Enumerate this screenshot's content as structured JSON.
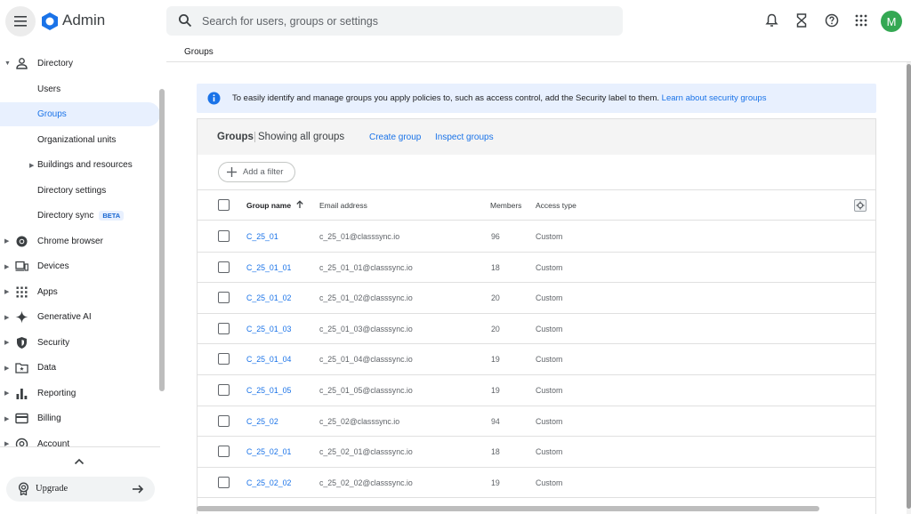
{
  "header": {
    "app_title": "Admin",
    "search_placeholder": "Search for users, groups or settings",
    "avatar_initial": "M"
  },
  "breadcrumb": "Groups",
  "sidebar": {
    "items": [
      {
        "label": "Directory",
        "icon": "person-icon",
        "expandable": true,
        "expanded": true
      },
      {
        "label": "Users",
        "level": 2
      },
      {
        "label": "Groups",
        "level": 2,
        "active": true
      },
      {
        "label": "Organizational units",
        "level": 2
      },
      {
        "label": "Buildings and resources",
        "level": 2,
        "expandable": true
      },
      {
        "label": "Directory settings",
        "level": 2
      },
      {
        "label": "Directory sync",
        "level": 2,
        "badge": "BETA"
      },
      {
        "label": "Chrome browser",
        "icon": "chrome-icon",
        "expandable": true
      },
      {
        "label": "Devices",
        "icon": "devices-icon",
        "expandable": true
      },
      {
        "label": "Apps",
        "icon": "apps-grid-icon",
        "expandable": true
      },
      {
        "label": "Generative AI",
        "icon": "sparkle-icon",
        "expandable": true
      },
      {
        "label": "Security",
        "icon": "shield-icon",
        "expandable": true
      },
      {
        "label": "Data",
        "icon": "folder-icon",
        "expandable": true
      },
      {
        "label": "Reporting",
        "icon": "bar-chart-icon",
        "expandable": true
      },
      {
        "label": "Billing",
        "icon": "credit-card-icon",
        "expandable": true
      },
      {
        "label": "Account",
        "icon": "account-icon",
        "expandable": true
      }
    ],
    "upgrade_label": "Upgrade"
  },
  "banner": {
    "text": "To easily identify and manage groups you apply policies to, such as access control, add the Security label to them.",
    "link": "Learn about security groups"
  },
  "card": {
    "title": "Groups",
    "subtitle": "Showing all groups",
    "create_link": "Create group",
    "inspect_link": "Inspect groups",
    "filter_label": "Add a filter"
  },
  "table": {
    "columns": {
      "name": "Group name",
      "email": "Email address",
      "members": "Members",
      "access": "Access type"
    },
    "rows": [
      {
        "name": "C_25_01",
        "email": "c_25_01@classsync.io",
        "members": "96",
        "access": "Custom"
      },
      {
        "name": "C_25_01_01",
        "email": "c_25_01_01@classsync.io",
        "members": "18",
        "access": "Custom"
      },
      {
        "name": "C_25_01_02",
        "email": "c_25_01_02@classsync.io",
        "members": "20",
        "access": "Custom"
      },
      {
        "name": "C_25_01_03",
        "email": "c_25_01_03@classsync.io",
        "members": "20",
        "access": "Custom"
      },
      {
        "name": "C_25_01_04",
        "email": "c_25_01_04@classsync.io",
        "members": "19",
        "access": "Custom"
      },
      {
        "name": "C_25_01_05",
        "email": "c_25_01_05@classsync.io",
        "members": "19",
        "access": "Custom"
      },
      {
        "name": "C_25_02",
        "email": "c_25_02@classsync.io",
        "members": "94",
        "access": "Custom"
      },
      {
        "name": "C_25_02_01",
        "email": "c_25_02_01@classsync.io",
        "members": "18",
        "access": "Custom"
      },
      {
        "name": "C_25_02_02",
        "email": "c_25_02_02@classsync.io",
        "members": "19",
        "access": "Custom"
      }
    ]
  },
  "colors": {
    "accent": "#1a73e8",
    "active_nav_bg": "#e8f0fe",
    "avatar_bg": "#34a853"
  }
}
